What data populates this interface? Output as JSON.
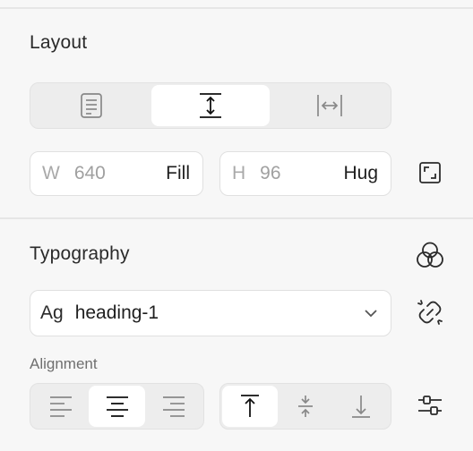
{
  "layout": {
    "title": "Layout",
    "mode_options": [
      {
        "icon": "document-icon",
        "active": false
      },
      {
        "icon": "vertical-resize-icon",
        "active": true
      },
      {
        "icon": "horizontal-resize-icon",
        "active": false
      }
    ],
    "width": {
      "key": "W",
      "value": "640",
      "mode": "Fill"
    },
    "height": {
      "key": "H",
      "value": "96",
      "mode": "Hug"
    },
    "resize_icon": "resize-to-fit-icon"
  },
  "typography": {
    "title": "Typography",
    "styles_icon": "style-circles-icon",
    "style_prefix": "Ag",
    "style_value": "heading-1",
    "detach_icon": "detach-link-icon",
    "alignment_label": "Alignment",
    "horizontal_align": [
      {
        "icon": "align-left-icon",
        "active": false
      },
      {
        "icon": "align-center-icon",
        "active": true
      },
      {
        "icon": "align-right-icon",
        "active": false
      }
    ],
    "vertical_align": [
      {
        "icon": "align-top-icon",
        "active": true
      },
      {
        "icon": "align-middle-icon",
        "active": false
      },
      {
        "icon": "align-bottom-icon",
        "active": false
      }
    ],
    "settings_icon": "adjust-sliders-icon"
  }
}
